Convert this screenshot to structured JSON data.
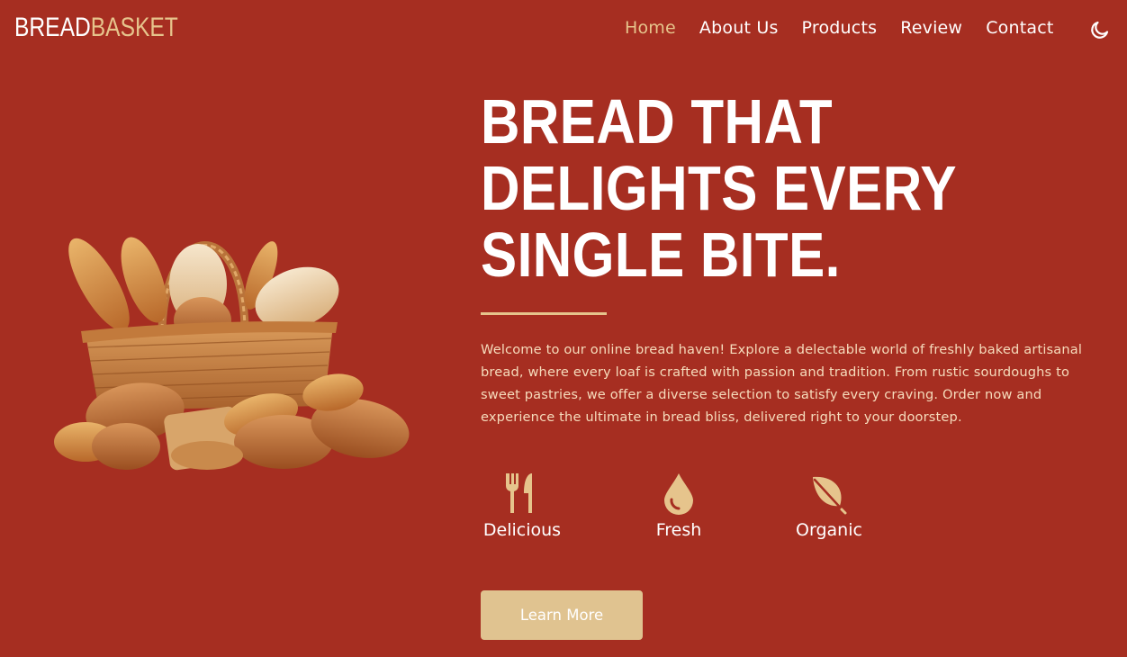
{
  "header": {
    "logo_part1": "BREAD",
    "logo_part2": "BASKET",
    "nav": [
      {
        "label": "Home",
        "active": true
      },
      {
        "label": "About Us"
      },
      {
        "label": "Products"
      },
      {
        "label": "Review"
      },
      {
        "label": "Contact"
      }
    ],
    "theme_icon": "moon-icon"
  },
  "hero": {
    "headline_line1": "BREAD THAT",
    "headline_line2": "DELIGHTS EVERY",
    "headline_line3": "SINGLE BITE.",
    "description": "Welcome to our online bread haven! Explore a delectable world of freshly baked artisanal bread, where every loaf is crafted with passion and tradition. From rustic sourdoughs to sweet pastries, we offer a diverse selection to satisfy every craving. Order now and experience the ultimate in bread bliss, delivered right to your doorstep.",
    "features": [
      {
        "label": "Delicious",
        "icon": "utensils-icon"
      },
      {
        "label": "Fresh",
        "icon": "droplet-icon"
      },
      {
        "label": "Organic",
        "icon": "leaf-icon"
      }
    ],
    "cta_label": "Learn More",
    "image_icon": "bread-basket-image"
  },
  "colors": {
    "background": "#a62e21",
    "accent": "#e6c48c",
    "button": "#e0c390"
  }
}
